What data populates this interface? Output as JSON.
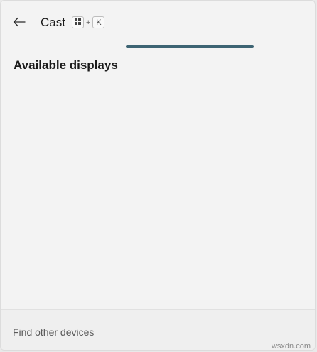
{
  "header": {
    "title": "Cast",
    "shortcut": {
      "key1_icon": "windows-logo-icon",
      "plus": "+",
      "key2": "K"
    }
  },
  "progress": {
    "value_percent": 65,
    "color": "#3d6473"
  },
  "main": {
    "section_title": "Available displays"
  },
  "footer": {
    "link_label": "Find other devices"
  },
  "watermark": {
    "text": "wsxdn.com"
  }
}
